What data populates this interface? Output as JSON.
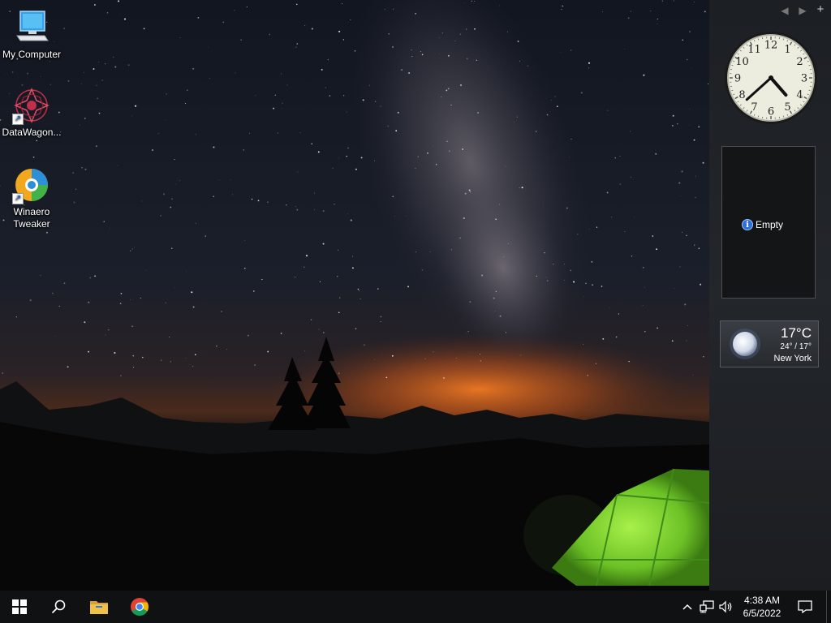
{
  "desktop": {
    "icons": [
      {
        "label": "My Computer",
        "icon": "computer-icon"
      },
      {
        "label": "DataWagon...",
        "icon": "datawagon-icon"
      },
      {
        "label": "Winaero",
        "label2": "Tweaker",
        "icon": "winaero-tweaker-icon"
      }
    ]
  },
  "sidebar": {
    "controls": {
      "prev": "◀",
      "next": "▶",
      "add": "+"
    },
    "clock": {
      "hour": 4,
      "minute": 38
    },
    "slideshow": {
      "status": "Empty"
    },
    "weather": {
      "temperature": "17°C",
      "range": "24° / 17°",
      "city": "New York"
    }
  },
  "taskbar": {
    "items": [
      "start-icon",
      "search-icon",
      "file-explorer-icon",
      "chrome-icon"
    ],
    "tray": {
      "time": "4:38 AM",
      "date": "6/5/2022",
      "icons": [
        "chevron-up-icon",
        "network-icon",
        "volume-icon",
        "notification-icon"
      ]
    }
  },
  "colors": {
    "taskbar": "#101113",
    "sidebar": "#202328",
    "tent": "#8fe23a",
    "horizon": "#e2661c",
    "explorer_folder": "#f1c04a",
    "info_blue": "#2f6fd1"
  }
}
